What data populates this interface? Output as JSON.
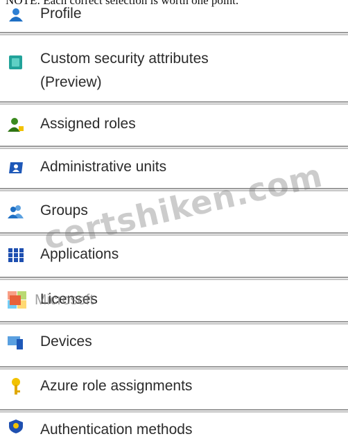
{
  "note": "NOTE: Each correct selection is worth one point.",
  "menu": {
    "items": [
      {
        "label": "Profile",
        "icon": "profile-icon"
      },
      {
        "label": "Custom security attributes",
        "label_line2": "(Preview)",
        "icon": "custom-security-attributes-icon"
      },
      {
        "label": "Assigned roles",
        "icon": "assigned-roles-icon"
      },
      {
        "label": "Administrative units",
        "icon": "administrative-units-icon"
      },
      {
        "label": "Groups",
        "icon": "groups-icon"
      },
      {
        "label": "Applications",
        "icon": "applications-icon"
      },
      {
        "label": "Licenses",
        "icon": "licenses-icon"
      },
      {
        "label": "Devices",
        "icon": "devices-icon"
      },
      {
        "label": "Azure role assignments",
        "icon": "azure-role-assignments-icon"
      },
      {
        "label": "Authentication methods",
        "icon": "authentication-methods-icon"
      }
    ]
  },
  "overlay": {
    "watermark": "certshiken.com",
    "microsoft_logo_text": "Microsoft"
  },
  "colors": {
    "accent_blue": "#1e6fc4",
    "teal": "#22a39a",
    "green": "#3a8a1e",
    "yellow": "#f2c200",
    "separator": "#9a9a9a"
  }
}
